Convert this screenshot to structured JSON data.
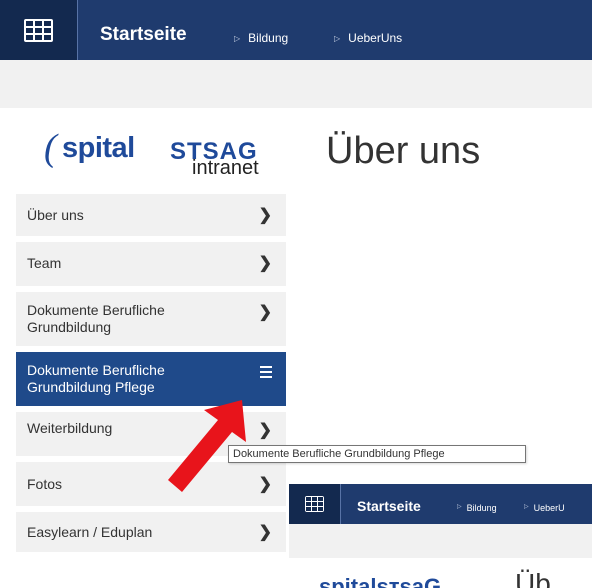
{
  "topbar": {
    "app_launcher_icon": "waffle-grid-icon",
    "brand": "Startseite",
    "breadcrumb": [
      {
        "label": "Bildung"
      },
      {
        "label": "UeberUns"
      }
    ]
  },
  "logo": {
    "text_main": "spital",
    "text_sts": "STSAG",
    "text_sub": "intranet"
  },
  "page": {
    "title": "Über uns"
  },
  "nav": {
    "items": [
      {
        "label": "Über uns",
        "icon": "chevron-right-icon"
      },
      {
        "label": "Team",
        "icon": "chevron-right-icon"
      },
      {
        "label": "Dokumente Berufliche Grundbildung",
        "icon": "chevron-right-icon"
      },
      {
        "label": "Dokumente Berufliche Grundbildung Pflege",
        "icon": "hamburger-menu-icon",
        "active": true
      },
      {
        "label": "Weiterbildung",
        "icon": "chevron-right-icon"
      },
      {
        "label": "Fotos",
        "icon": "chevron-right-icon"
      },
      {
        "label": "Easylearn / Eduplan",
        "icon": "chevron-right-icon"
      }
    ]
  },
  "tooltip": {
    "text": "Dokumente Berufliche Grundbildung Pflege"
  },
  "annotation": {
    "arrow_color": "#e8141b"
  },
  "nested_screenshot": {
    "brand": "Startseite",
    "breadcrumb": [
      "Bildung",
      "UeberU"
    ],
    "logo_partial": "spitalsтsaG",
    "title_partial": "Üb"
  },
  "colors": {
    "topbar": "#1f3b6e",
    "active_nav": "#1f4a8a",
    "nav_bg": "#f1f1f1"
  }
}
